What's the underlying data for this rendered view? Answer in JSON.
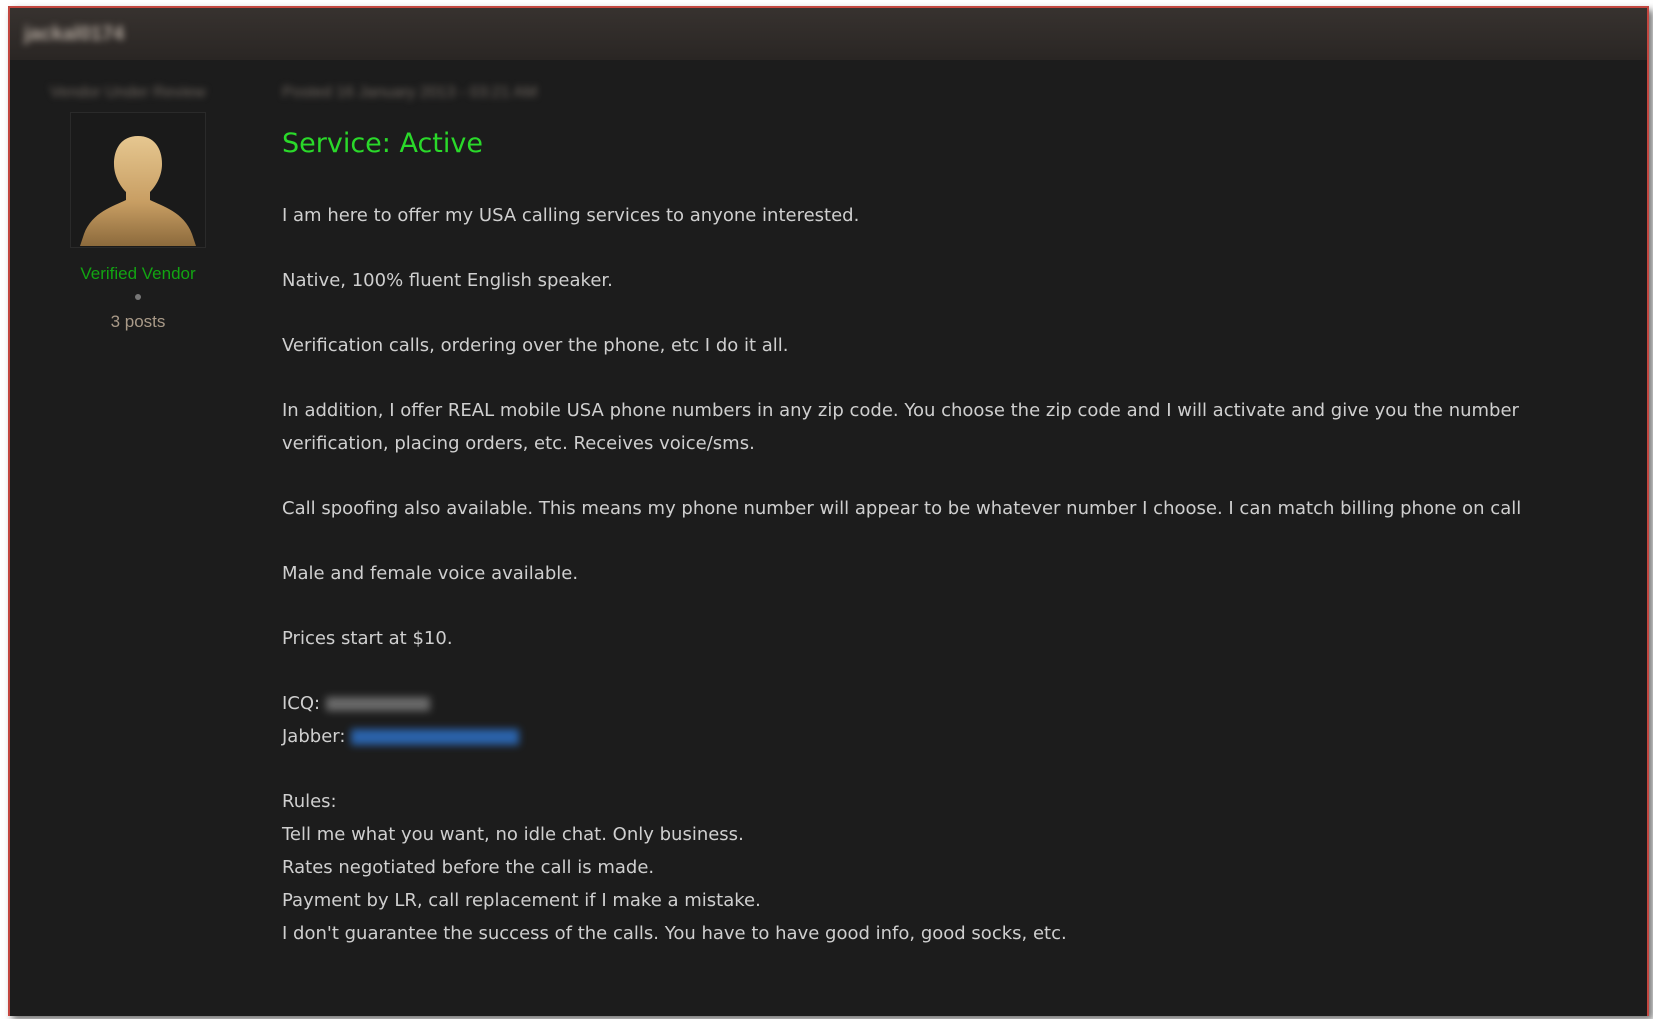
{
  "header": {
    "username_blurred": "jackal0174"
  },
  "post_meta": {
    "user_blurred": "Vendor Under Review",
    "date_blurred": "Posted 16 January 2013 - 03:21 AM"
  },
  "sidebar": {
    "avatar_icon": "user-silhouette-icon",
    "rank": "Verified Vendor",
    "posts": "3 posts"
  },
  "post": {
    "title": "Service: Active",
    "paragraphs": [
      "I am here to offer my USA calling services to anyone interested.",
      "Native, 100% fluent English speaker.",
      "Verification calls, ordering over the phone, etc I do it all.",
      "In addition, I offer REAL mobile USA phone numbers in any zip code. You choose the zip code and I will activate and give you the number",
      "verification, placing orders, etc. Receives voice/sms.",
      "Call spoofing also available. This means my phone number will appear to be whatever number I choose. I can match billing phone on call",
      "Male and female voice available.",
      "Prices start at $10."
    ],
    "icq_label": "ICQ:",
    "jabber_label": "Jabber:",
    "rules_label": "Rules:",
    "rules": [
      "Tell me what you want, no idle chat. Only business.",
      "Rates negotiated before the call is made.",
      "Payment by LR, call replacement if I make a mistake.",
      "I don't guarantee the success of the calls. You have to have good info, good socks, etc."
    ]
  },
  "colors": {
    "background": "#1c1c1c",
    "title_green": "#2ad92a",
    "rank_green": "#12a412",
    "border_red": "#c2463f",
    "link_blue": "#2d6fc4"
  }
}
